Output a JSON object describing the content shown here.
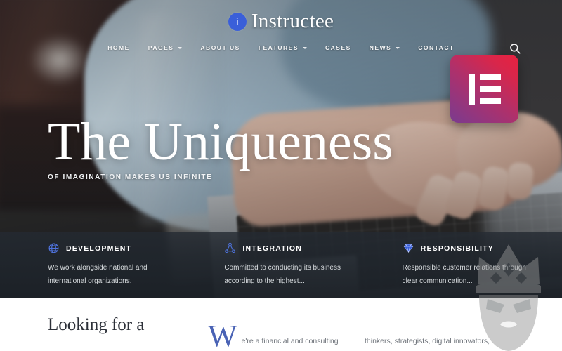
{
  "site": {
    "logo_icon": "circle-i-icon",
    "logo_letter": "i",
    "logo_text": "Instructee",
    "accent_color": "#3a5fd9"
  },
  "nav": {
    "items": [
      {
        "label": "HOME",
        "has_dropdown": false,
        "active": true
      },
      {
        "label": "PAGES",
        "has_dropdown": true,
        "active": false
      },
      {
        "label": "ABOUT US",
        "has_dropdown": false,
        "active": false
      },
      {
        "label": "FEATURES",
        "has_dropdown": true,
        "active": false
      },
      {
        "label": "CASES",
        "has_dropdown": false,
        "active": false
      },
      {
        "label": "NEWS",
        "has_dropdown": true,
        "active": false
      },
      {
        "label": "CONTACT",
        "has_dropdown": false,
        "active": false
      }
    ],
    "search_icon": "search-icon"
  },
  "badge": {
    "name": "elementor-logo",
    "gradient_from": "#7a3b8f",
    "gradient_to": "#e8213f"
  },
  "hero": {
    "title": "The Uniqueness",
    "subtitle": "OF IMAGINATION MAKES US INFINITE"
  },
  "features": [
    {
      "icon": "globe-icon",
      "title": "DEVELOPMENT",
      "desc": "We work alongside national and international organizations."
    },
    {
      "icon": "network-nodes-icon",
      "title": "INTEGRATION",
      "desc": "Committed to conducting its business according to the highest..."
    },
    {
      "icon": "diamond-icon",
      "title": "RESPONSIBILITY",
      "desc": "Responsible customer relations through clear communication..."
    }
  ],
  "intro": {
    "heading": "Looking for a",
    "dropcap": "W",
    "paragraph_mid": "e're a financial and consulting",
    "paragraph_right": "thinkers, strategists, digital innovators,"
  },
  "watermark": {
    "name": "king-crown-face-watermark"
  }
}
